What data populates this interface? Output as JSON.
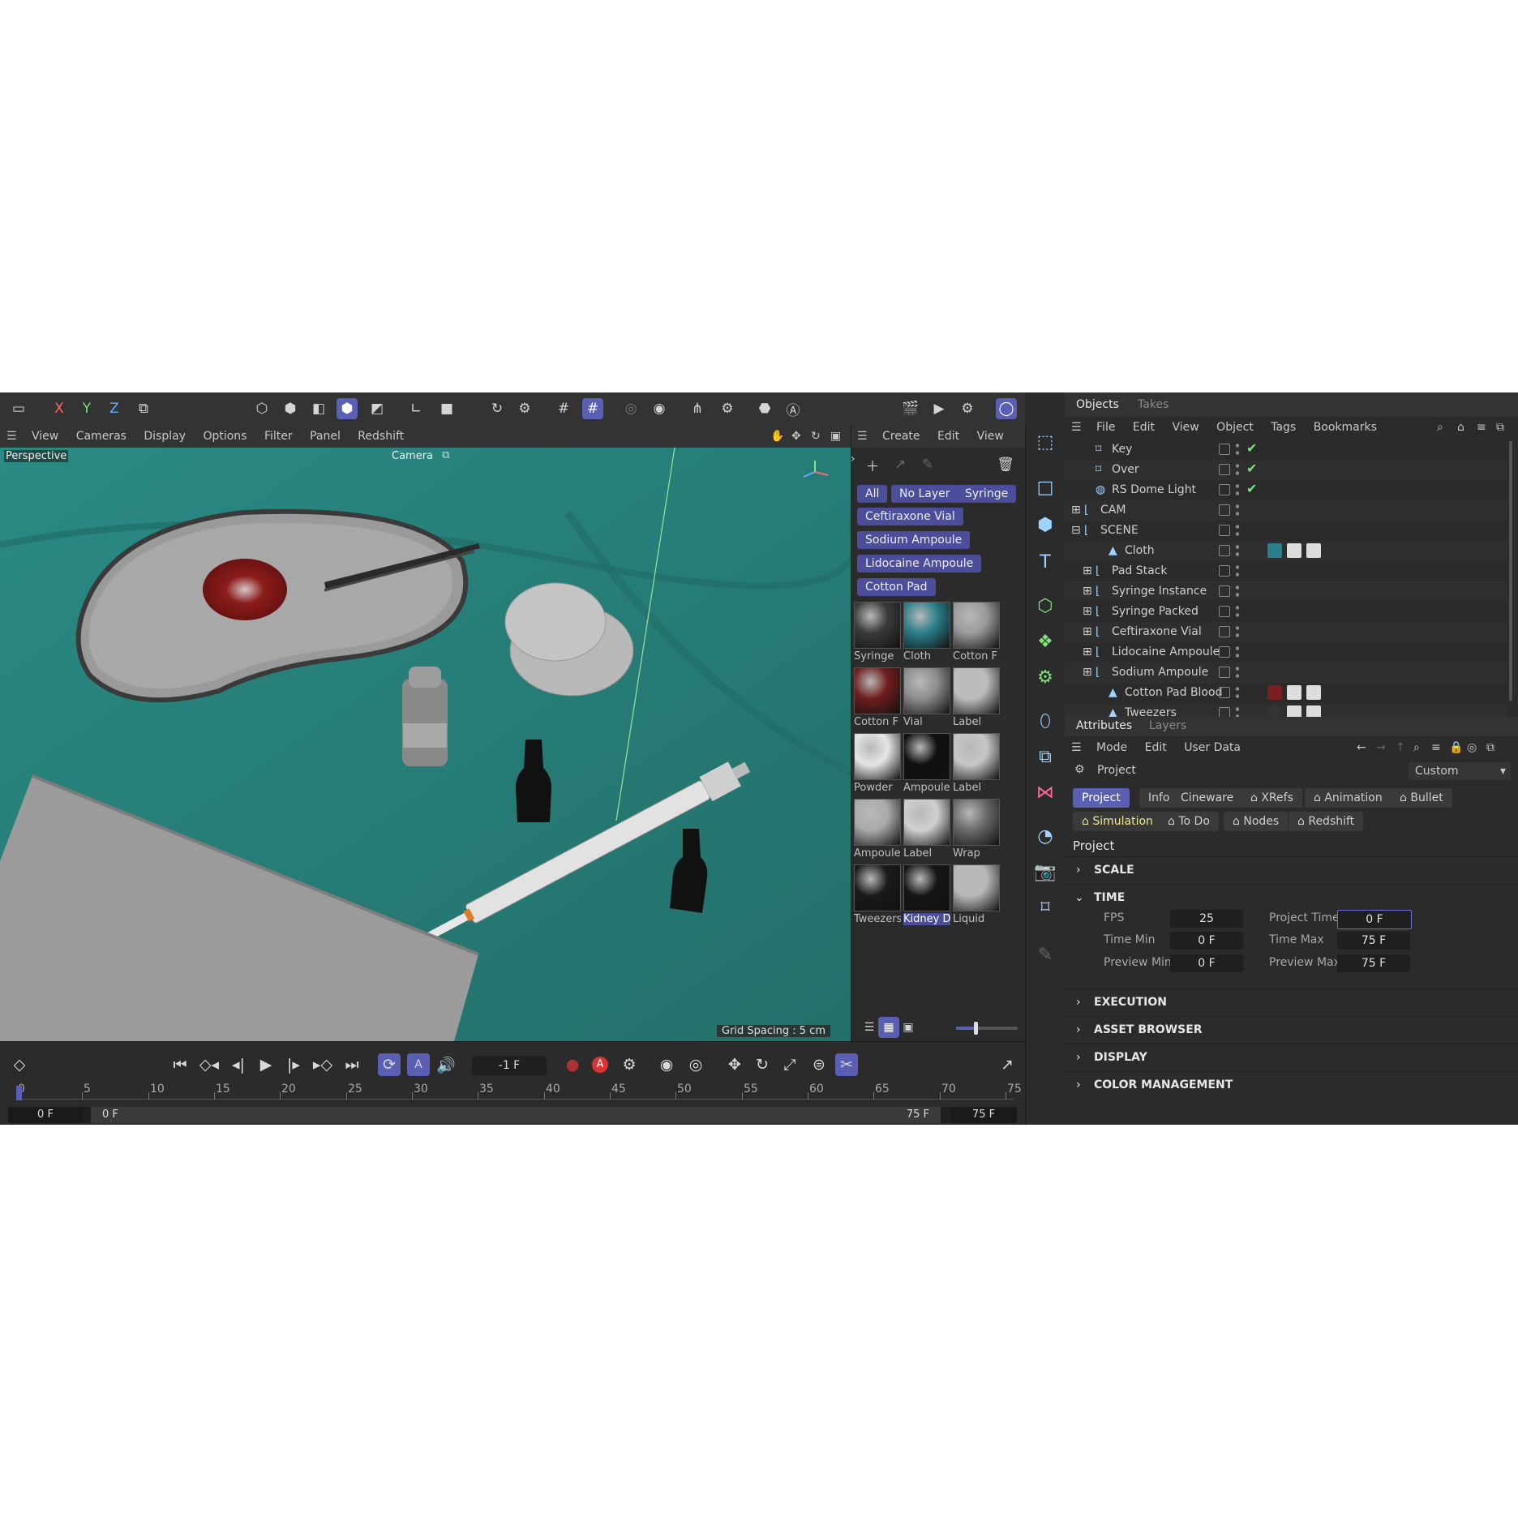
{
  "top_toolbar": {
    "axes": [
      "X",
      "Y",
      "Z"
    ]
  },
  "viewport": {
    "menu": [
      "View",
      "Cameras",
      "Display",
      "Options",
      "Filter",
      "Panel",
      "Redshift"
    ],
    "view_name": "Perspective",
    "camera_label": "Camera",
    "grid_spacing": "Grid Spacing : 5 cm"
  },
  "material_manager": {
    "menu": [
      "Create",
      "Edit",
      "View"
    ],
    "filter_chips": [
      "All",
      "No Layer",
      "Syringe",
      "Ceftiraxone Vial",
      "Sodium Ampoule",
      "Lidocaine Ampoule",
      "Cotton Pad"
    ],
    "materials": [
      {
        "name": "Syringe",
        "color": "#3a3a3a"
      },
      {
        "name": "Cloth",
        "color": "#2a7f8a"
      },
      {
        "name": "Cotton F",
        "color": "#9a9a9a"
      },
      {
        "name": "Cotton F",
        "color": "#6e1d1d"
      },
      {
        "name": "Vial",
        "color": "#8d8d8d"
      },
      {
        "name": "Label",
        "color": "#bdbdbd"
      },
      {
        "name": "Powder",
        "color": "#e6e6e6"
      },
      {
        "name": "Ampoule",
        "color": "#101010"
      },
      {
        "name": "Label",
        "color": "#c7c7c7"
      },
      {
        "name": "Ampoule",
        "color": "#aaaaaa"
      },
      {
        "name": "Label",
        "color": "#d0d0d0"
      },
      {
        "name": "Wrap",
        "color": "#6a6a6a"
      },
      {
        "name": "Tweezers",
        "color": "#1a1a1a"
      },
      {
        "name": "Kidney D",
        "color": "#151515"
      },
      {
        "name": "Liquid",
        "color": "#b9b9b9"
      }
    ]
  },
  "objects_panel": {
    "tabs": [
      "Objects",
      "Takes"
    ],
    "menu": [
      "File",
      "Edit",
      "View",
      "Object",
      "Tags",
      "Bookmarks"
    ],
    "rows": [
      {
        "name": "Key",
        "checked": true
      },
      {
        "name": "Over",
        "checked": true
      },
      {
        "name": "RS Dome Light",
        "checked": true
      },
      {
        "name": "CAM",
        "checked": false
      },
      {
        "name": "SCENE",
        "checked": false
      },
      {
        "name": "Cloth",
        "checked": false
      },
      {
        "name": "Pad Stack",
        "checked": false
      },
      {
        "name": "Syringe Instance",
        "checked": false
      },
      {
        "name": "Syringe Packed",
        "checked": false
      },
      {
        "name": "Ceftiraxone Vial",
        "checked": false
      },
      {
        "name": "Lidocaine Ampoule",
        "checked": false
      },
      {
        "name": "Sodium Ampoule",
        "checked": false
      },
      {
        "name": "Cotton Pad Blood",
        "checked": false
      },
      {
        "name": "Tweezers",
        "checked": false
      }
    ]
  },
  "attributes_panel": {
    "tabs": [
      "Attributes",
      "Layers"
    ],
    "menu": [
      "Mode",
      "Edit",
      "User Data"
    ],
    "object_type": "Project",
    "preset": "Custom",
    "subtabs_row1": [
      "Project",
      "Info",
      "Cineware",
      "XRefs",
      "Animation",
      "Bullet"
    ],
    "subtabs_row2": [
      "Simulation",
      "To Do",
      "Nodes",
      "Redshift"
    ],
    "section_title": "Project",
    "sections": {
      "scale": "SCALE",
      "time": "TIME",
      "execution": "EXECUTION",
      "asset_browser": "ASSET BROWSER",
      "display": "DISPLAY",
      "color_management": "COLOR MANAGEMENT"
    },
    "time_fields": {
      "fps_label": "FPS",
      "fps": "25",
      "project_time_label": "Project Time",
      "project_time": "0 F",
      "time_min_label": "Time Min",
      "time_min": "0 F",
      "time_max_label": "Time Max",
      "time_max": "75 F",
      "preview_min_label": "Preview Min",
      "preview_min": "0 F",
      "preview_max_label": "Preview Max",
      "preview_max": "75 F"
    }
  },
  "timeline": {
    "current_frame": "-1 F",
    "ticks": [
      "0",
      "5",
      "10",
      "15",
      "20",
      "25",
      "30",
      "35",
      "40",
      "45",
      "50",
      "55",
      "60",
      "65",
      "70",
      "75"
    ],
    "range_start": "0 F",
    "preview_start": "0 F",
    "preview_end": "75 F",
    "range_end": "75 F"
  },
  "colors": {
    "accent": "#5b5fb4",
    "panel_bg": "#2b2b2b",
    "viewport_floor": "#2c8d87",
    "check_green": "#7de37a"
  }
}
